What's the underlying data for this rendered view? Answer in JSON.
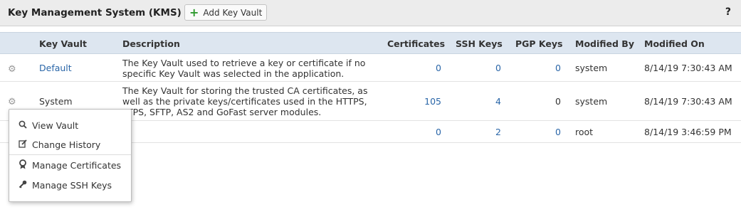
{
  "header": {
    "title": "Key Management System (KMS)",
    "add_button": "Add Key Vault",
    "help": "?"
  },
  "table": {
    "columns": [
      "Key Vault",
      "Description",
      "Certificates",
      "SSH Keys",
      "PGP Keys",
      "Modified By",
      "Modified On"
    ],
    "rows": [
      {
        "name": "Default",
        "description": "The Key Vault used to retrieve a key or certificate if no specific Key Vault was selected in the application.",
        "certificates": "0",
        "ssh_keys": "0",
        "pgp_keys": "0",
        "modified_by": "system",
        "modified_on": "8/14/19 7:30:43 AM"
      },
      {
        "name": "System",
        "description": "The Key Vault for storing the trusted CA certificates, as well as the private keys/certificates used in the HTTPS, FTPS, SFTP, AS2 and GoFast server modules.",
        "certificates": "105",
        "ssh_keys": "4",
        "pgp_keys": "0",
        "modified_by": "system",
        "modified_on": "8/14/19 7:30:43 AM"
      },
      {
        "name": "",
        "description": "",
        "certificates": "0",
        "ssh_keys": "2",
        "pgp_keys": "0",
        "modified_by": "root",
        "modified_on": "8/14/19 3:46:59 PM"
      }
    ]
  },
  "context_menu": {
    "items": [
      {
        "label": "View Vault",
        "icon": "search-icon"
      },
      {
        "label": "Change History",
        "icon": "edit-icon"
      },
      {
        "label": "Manage Certificates",
        "icon": "certificate-icon"
      },
      {
        "label": "Manage SSH Keys",
        "icon": "key-icon"
      }
    ]
  }
}
